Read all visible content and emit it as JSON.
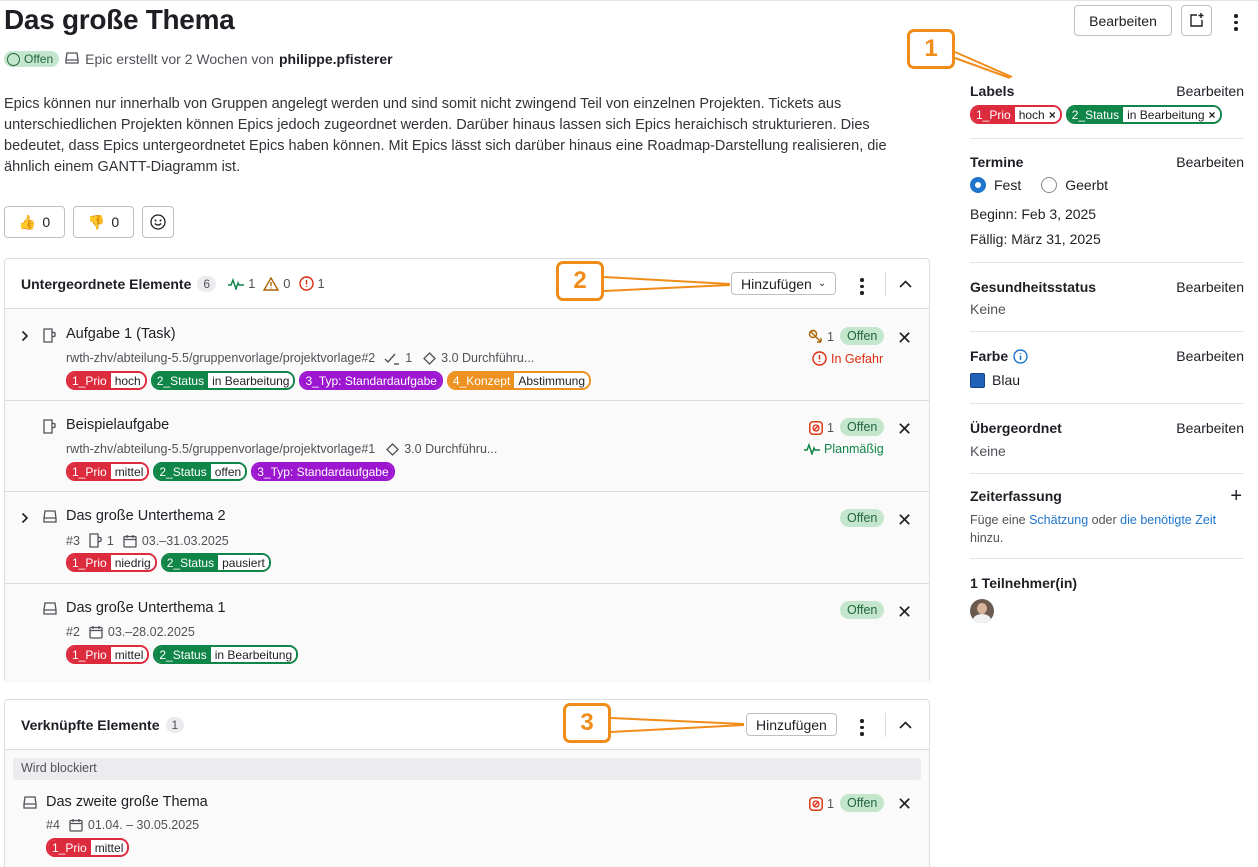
{
  "header": {
    "title": "Das große Thema",
    "status": "Offen",
    "meta_text": "Epic erstellt vor 2 Wochen von",
    "author": "philippe.pfisterer",
    "edit_button": "Bearbeiten"
  },
  "description": "Epics können nur innerhalb von Gruppen angelegt werden und sind somit nicht zwingend Teil von einzelnen Projekten. Tickets aus unterschiedlichen Projekten können Epics jedoch zugeordnet werden. Darüber hinaus lassen sich Epics heraichisch strukturieren. Dies bedeutet, dass Epics untergeordnetet Epics haben können. Mit Epics lässt sich darüber hinaus eine Roadmap-Darstellung realisieren, die ähnlich einem GANTT-Diagramm ist.",
  "reactions": {
    "thumbs_up": "0",
    "thumbs_down": "0"
  },
  "children": {
    "title": "Untergeordnete Elemente",
    "count": "6",
    "on_track": "1",
    "needs_attention": "0",
    "at_risk": "1",
    "add_button": "Hinzufügen",
    "items": [
      {
        "title": "Aufgabe 1 (Task)",
        "path": "rwth-zhv/abteilung-5.5/gruppenvorlage/projektvorlage#2",
        "done": "1",
        "milestone": "3.0 Durchführu...",
        "blocking": "1",
        "status": "Offen",
        "health": "In Gefahr",
        "labels": [
          {
            "k": "1_Prio",
            "v": "hoch",
            "color": "#dd2b3e"
          },
          {
            "k": "2_Status",
            "v": "in Bearbeitung",
            "color": "#108548"
          },
          {
            "k": "3_Typ: Standardaufgabe",
            "v": "",
            "color": "#9e17d0"
          },
          {
            "k": "4_Konzept",
            "v": "Abstimmung",
            "color": "#ed9121"
          }
        ]
      },
      {
        "title": "Beispielaufgabe",
        "path": "rwth-zhv/abteilung-5.5/gruppenvorlage/projektvorlage#1",
        "milestone": "3.0 Durchführu...",
        "blocked": "1",
        "status": "Offen",
        "health": "Planmäßig",
        "labels": [
          {
            "k": "1_Prio",
            "v": "mittel",
            "color": "#dd2b3e"
          },
          {
            "k": "2_Status",
            "v": "offen",
            "color": "#108548"
          },
          {
            "k": "3_Typ: Standardaufgabe",
            "v": "",
            "color": "#9e17d0"
          }
        ]
      },
      {
        "title": "Das große Unterthema 2",
        "ref": "#3",
        "issues": "1",
        "dates": "03.–31.03.2025",
        "status": "Offen",
        "labels": [
          {
            "k": "1_Prio",
            "v": "niedrig",
            "color": "#dd2b3e"
          },
          {
            "k": "2_Status",
            "v": "pausiert",
            "color": "#108548"
          }
        ]
      },
      {
        "title": "Das große Unterthema 1",
        "ref": "#2",
        "dates": "03.–28.02.2025",
        "status": "Offen",
        "labels": [
          {
            "k": "1_Prio",
            "v": "mittel",
            "color": "#dd2b3e"
          },
          {
            "k": "2_Status",
            "v": "in Bearbeitung",
            "color": "#108548"
          }
        ]
      }
    ]
  },
  "linked": {
    "title": "Verknüpfte Elemente",
    "count": "1",
    "add_button": "Hinzufügen",
    "group_label": "Wird blockiert",
    "item": {
      "title": "Das zweite große Thema",
      "ref": "#4",
      "dates": "01.04. – 30.05.2025",
      "blocked": "1",
      "status": "Offen",
      "labels": [
        {
          "k": "1_Prio",
          "v": "mittel",
          "color": "#dd2b3e"
        }
      ]
    }
  },
  "sidebar": {
    "edit": "Bearbeiten",
    "labels_title": "Labels",
    "labels": [
      {
        "k": "1_Prio",
        "v": "hoch",
        "color": "#dd2b3e"
      },
      {
        "k": "2_Status",
        "v": "in Bearbeitung",
        "color": "#108548"
      }
    ],
    "dates_title": "Termine",
    "fixed": "Fest",
    "inherited": "Geerbt",
    "start": "Beginn: Feb 3, 2025",
    "due": "Fällig: März 31, 2025",
    "health_title": "Gesundheitsstatus",
    "health_value": "Keine",
    "color_title": "Farbe",
    "color_value": "Blau",
    "color_swatch": "#1f62b8",
    "parent_title": "Übergeordnet",
    "parent_value": "Keine",
    "time_title": "Zeiterfassung",
    "time_pre": "Füge eine",
    "time_link1": "Schätzung",
    "time_mid": "oder",
    "time_link2": "die benötigte Zeit",
    "time_post": "hinzu.",
    "participants": "1 Teilnehmer(in)"
  },
  "callouts": [
    "1",
    "2",
    "3"
  ],
  "accent": "#f08c1a"
}
